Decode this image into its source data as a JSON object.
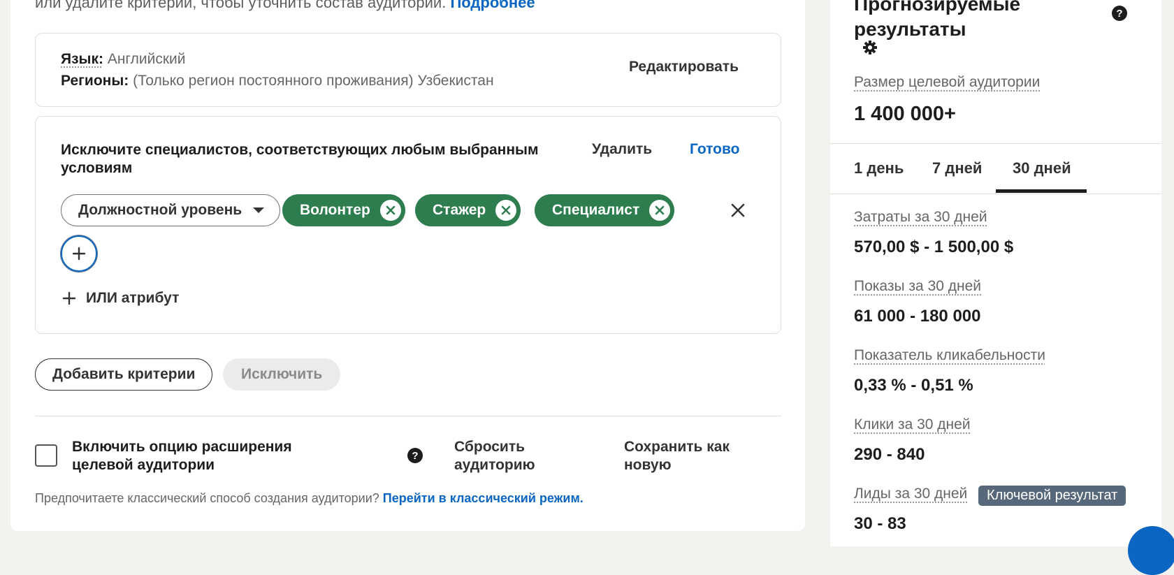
{
  "intro": {
    "text": "или удалите критерии, чтобы уточнить состав аудитории.",
    "link": "Подробнее"
  },
  "locale_card": {
    "language_key": "Язык:",
    "language_value": "Английский",
    "regions_key": "Регионы:",
    "regions_value": "(Только регион постоянного проживания) Узбекистан",
    "edit_label": "Редактировать"
  },
  "exclude_card": {
    "title": "Исключите специалистов, соответствующих любым выбранным условиям",
    "delete_label": "Удалить",
    "done_label": "Готово",
    "facet_label": "Должностной уровень",
    "chips": [
      "Волонтер",
      "Стажер",
      "Специалист"
    ],
    "or_attribute_label": "ИЛИ атрибут"
  },
  "actions": {
    "add_criteria": "Добавить критерии",
    "exclude": "Исключить"
  },
  "footer": {
    "expansion_label": "Включить опцию расширения целевой аудитории",
    "reset_label": "Сбросить аудиторию",
    "save_new_label": "Сохранить как новую",
    "classic_text": "Предпочитаете классический способ создания аудитории?",
    "classic_link": "Перейти в классический режим."
  },
  "forecast": {
    "title": "Прогнозируемые результаты",
    "audience_size_label": "Размер целевой аудитории",
    "audience_size_value": "1 400 000+",
    "tabs": [
      "1 день",
      "7 дней",
      "30 дней"
    ],
    "active_tab": "30 дней",
    "metrics": [
      {
        "label": "Затраты за 30 дней",
        "value": "570,00 $ - 1 500,00 $"
      },
      {
        "label": "Показы за 30 дней",
        "value": "61 000 - 180 000"
      },
      {
        "label": "Показатель кликабельности",
        "value": "0,33 % - 0,51 %"
      },
      {
        "label": "Клики за 30 дней",
        "value": "290 - 840"
      },
      {
        "label": "Лиды за 30 дней",
        "value": "30 - 83"
      }
    ],
    "key_result_badge": "Ключевой результат"
  },
  "colors": {
    "accent": "#0a66c2",
    "chip_green": "#2e7d4f",
    "badge": "#56687a"
  }
}
